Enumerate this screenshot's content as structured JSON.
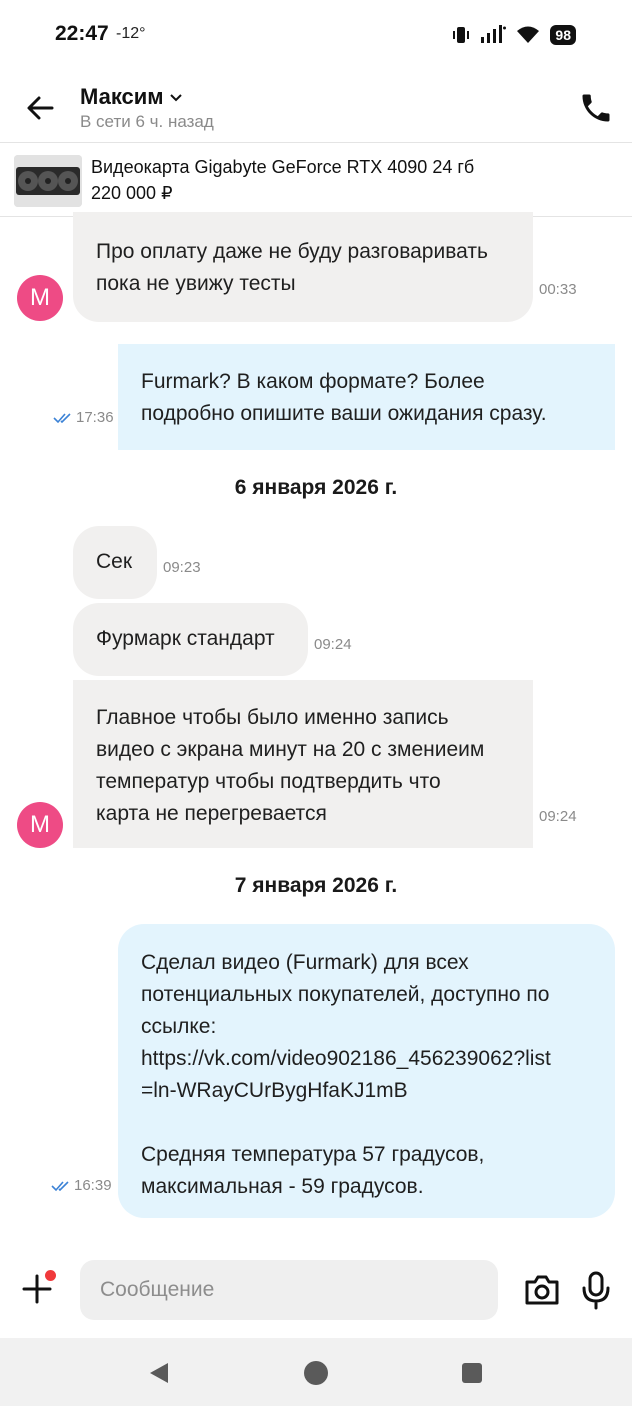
{
  "status_bar": {
    "time": "22:47",
    "temperature": "-12°",
    "battery": "98"
  },
  "header": {
    "name": "Максим",
    "status": "В сети 6 ч. назад"
  },
  "product": {
    "title": "Видеокарта Gigabyte GeForce RTX 4090 24 гб",
    "price": "220 000 ₽"
  },
  "avatar_letter": "M",
  "messages": {
    "m1": {
      "lines": [
        "Про оплату даже не буду разговаривать",
        "пока не увижу тесты"
      ],
      "time": "00:33"
    },
    "m2": {
      "lines": [
        "Furmark? В каком формате? Более",
        "подробно опишите ваши ожидания сразу."
      ],
      "time": "17:36"
    },
    "date1": "6 января 2026 г.",
    "m3": {
      "text": "Сек",
      "time": "09:23"
    },
    "m4": {
      "text": "Фурмарк стандарт",
      "time": "09:24"
    },
    "m5": {
      "lines": [
        "Главное чтобы было именно запись",
        "видео с экрана минут на 20 с змениеим",
        "температур чтобы подтвердить что",
        "карта не перегревается"
      ],
      "time": "09:24"
    },
    "date2": "7 января 2026 г.",
    "m6": {
      "lines": [
        "Сделал видео (Furmark) для всех",
        "потенциальных покупателей, доступно по",
        "ссылке:",
        "https://vk.com/video902186_456239062?list",
        "=ln-WRayCUrBygHfaKJ1mB",
        "",
        "Средняя температура 57 градусов,",
        "максимальная - 59 градусов."
      ],
      "time": "16:39"
    }
  },
  "input": {
    "placeholder": "Сообщение"
  },
  "colors": {
    "incoming": "#f1f0ef",
    "outgoing": "#e3f4fd",
    "avatar": "#ee4b85",
    "read_check": "#3b82d6"
  }
}
